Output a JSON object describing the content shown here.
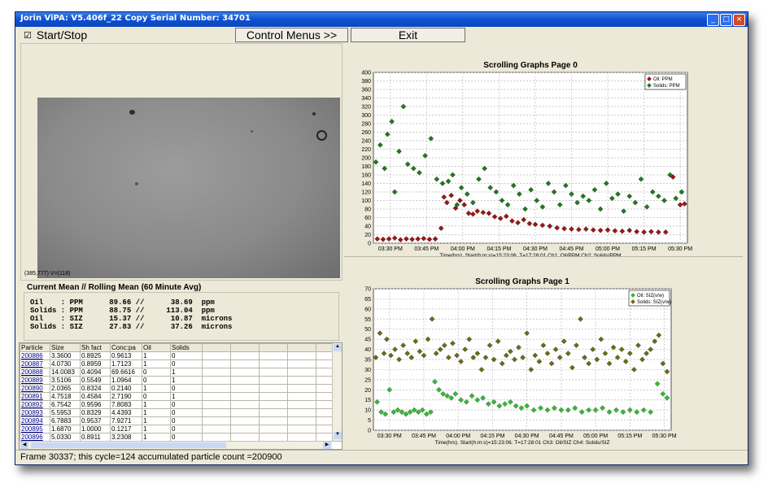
{
  "window": {
    "title": "Jorin ViPA: V5.406f_22 Copy Serial Number: 34701"
  },
  "toolbar": {
    "start_stop_label": "Start/Stop",
    "start_stop_checked": true,
    "control_menus_label": "Control Menus >>",
    "exit_label": "Exit"
  },
  "video": {
    "readout": "(385,777)  V=(118)"
  },
  "stats": {
    "title": "Current Mean // Rolling Mean (60 Minute Avg)",
    "rows": [
      "Oil    : PPM      89.66 //      38.69  ppm",
      "Solids : PPM      88.75 //     113.04  ppm",
      "Oil    : SIZ      15.37 //      10.87  microns",
      "Solids : SIZ      27.83 //      37.26  microns"
    ]
  },
  "table": {
    "headers": [
      "Particle",
      "Size",
      "Sh fact",
      "Conc:pa",
      "Oil",
      "Solids",
      "",
      "",
      "",
      "",
      ""
    ],
    "rows": [
      [
        "200886",
        "3.3600",
        "0.8925",
        "0.9613",
        "1",
        "0"
      ],
      [
        "200887",
        "4.0730",
        "0.8959",
        "1.7123",
        "1",
        "0"
      ],
      [
        "200888",
        "14.0083",
        "0.4094",
        "69.6616",
        "0",
        "1"
      ],
      [
        "200889",
        "3.5106",
        "0.5549",
        "1.0964",
        "0",
        "1"
      ],
      [
        "200890",
        "2.0365",
        "0.8324",
        "0.2140",
        "1",
        "0"
      ],
      [
        "200891",
        "4.7518",
        "0.4584",
        "2.7190",
        "0",
        "1"
      ],
      [
        "200892",
        "6.7542",
        "0.9596",
        "7.8083",
        "1",
        "0"
      ],
      [
        "200893",
        "5.5953",
        "0.8329",
        "4.4393",
        "1",
        "0"
      ],
      [
        "200894",
        "6.7883",
        "0.9537",
        "7.9271",
        "1",
        "0"
      ],
      [
        "200895",
        "1.6870",
        "1.0000",
        "0.1217",
        "1",
        "0"
      ],
      [
        "200896",
        "5.0330",
        "0.8911",
        "3.2308",
        "1",
        "0"
      ]
    ]
  },
  "status": {
    "text": "Frame 30337; this cycle=124 accumulated particle count =200900"
  },
  "chart_data": [
    {
      "type": "scatter",
      "title": "Scrolling Graphs Page 0",
      "xlabel": "Time(hrs). Start(h:m:s)=15:23:06.  T=17:28:01  Ch1: Oil/PPM  Ch2: Solids/PPM",
      "ylabel": "",
      "xlim": [
        15.383,
        17.55
      ],
      "ylim": [
        0,
        400
      ],
      "yticks": [
        0,
        20,
        40,
        60,
        80,
        100,
        120,
        140,
        160,
        180,
        200,
        220,
        240,
        260,
        280,
        300,
        320,
        340,
        360,
        380,
        400
      ],
      "xticks": [
        "03:30 PM",
        "03:45 PM",
        "04:00 PM",
        "04:15 PM",
        "04:30 PM",
        "04:45 PM",
        "05:00 PM",
        "05:15 PM",
        "05:30 PM"
      ],
      "xtick_values": [
        15.5,
        15.75,
        16.0,
        16.25,
        16.5,
        16.75,
        17.0,
        17.25,
        17.5
      ],
      "grid": true,
      "legend": "top-right",
      "series": [
        {
          "name": "Oil: PPM",
          "color": "#9e1414",
          "x": [
            15.41,
            15.45,
            15.49,
            15.53,
            15.57,
            15.61,
            15.65,
            15.69,
            15.73,
            15.77,
            15.81,
            15.85,
            15.87,
            15.89,
            15.92,
            15.95,
            15.98,
            16.01,
            16.04,
            16.07,
            16.1,
            16.14,
            16.18,
            16.22,
            16.26,
            16.3,
            16.34,
            16.38,
            16.42,
            16.46,
            16.5,
            16.55,
            16.6,
            16.65,
            16.7,
            16.75,
            16.8,
            16.85,
            16.9,
            16.95,
            17.0,
            17.05,
            17.1,
            17.15,
            17.2,
            17.25,
            17.3,
            17.35,
            17.4,
            17.45,
            17.5,
            17.53
          ],
          "y": [
            10,
            9,
            10,
            12,
            8,
            10,
            9,
            10,
            11,
            9,
            10,
            35,
            108,
            95,
            112,
            82,
            100,
            90,
            70,
            68,
            75,
            72,
            70,
            62,
            58,
            63,
            52,
            48,
            55,
            46,
            44,
            42,
            40,
            36,
            34,
            33,
            32,
            33,
            31,
            30,
            31,
            29,
            28,
            30,
            27,
            26,
            27,
            26,
            26,
            155,
            90,
            92
          ]
        },
        {
          "name": "Solids: PPM",
          "color": "#1f7a1f",
          "x": [
            15.4,
            15.43,
            15.46,
            15.48,
            15.51,
            15.53,
            15.56,
            15.59,
            15.62,
            15.66,
            15.7,
            15.74,
            15.78,
            15.82,
            15.86,
            15.9,
            15.93,
            15.96,
            15.99,
            16.03,
            16.07,
            16.11,
            16.15,
            16.19,
            16.23,
            16.27,
            16.31,
            16.35,
            16.39,
            16.43,
            16.47,
            16.51,
            16.55,
            16.59,
            16.63,
            16.67,
            16.71,
            16.75,
            16.79,
            16.83,
            16.87,
            16.91,
            16.95,
            16.99,
            17.03,
            17.07,
            17.11,
            17.15,
            17.19,
            17.23,
            17.27,
            17.31,
            17.35,
            17.39,
            17.43,
            17.47,
            17.51
          ],
          "y": [
            190,
            230,
            175,
            255,
            285,
            120,
            215,
            320,
            185,
            175,
            165,
            205,
            245,
            150,
            140,
            145,
            160,
            90,
            130,
            115,
            95,
            150,
            175,
            130,
            120,
            100,
            90,
            135,
            115,
            80,
            125,
            100,
            85,
            140,
            120,
            90,
            135,
            115,
            95,
            110,
            100,
            125,
            80,
            140,
            105,
            115,
            75,
            110,
            95,
            150,
            85,
            120,
            110,
            100,
            160,
            105,
            120
          ]
        }
      ]
    },
    {
      "type": "scatter",
      "title": "Scrolling Graphs Page 1",
      "xlabel": "Time(hrs). Start(h:m:s)=15:23:06.  T=17:28:01  Ch3: Oil/SIZ  Ch4: Solids/SIZ",
      "ylabel": "",
      "xlim": [
        15.383,
        17.55
      ],
      "ylim": [
        0,
        70
      ],
      "yticks": [
        0,
        5,
        10,
        15,
        20,
        25,
        30,
        35,
        40,
        45,
        50,
        55,
        60,
        65,
        70
      ],
      "xticks": [
        "03:30 PM",
        "03:45 PM",
        "04:00 PM",
        "04:15 PM",
        "04:30 PM",
        "04:45 PM",
        "05:00 PM",
        "05:15 PM",
        "05:30 PM"
      ],
      "xtick_values": [
        15.5,
        15.75,
        16.0,
        16.25,
        16.5,
        16.75,
        17.0,
        17.25,
        17.5
      ],
      "grid": true,
      "legend": "top-right",
      "series": [
        {
          "name": "Oil: SIZ(v/w)",
          "color": "#33bb33",
          "x": [
            15.41,
            15.44,
            15.47,
            15.5,
            15.53,
            15.56,
            15.59,
            15.62,
            15.65,
            15.68,
            15.71,
            15.74,
            15.77,
            15.8,
            15.83,
            15.86,
            15.89,
            15.92,
            15.95,
            15.98,
            16.02,
            16.06,
            16.1,
            16.14,
            16.18,
            16.22,
            16.26,
            16.3,
            16.34,
            16.38,
            16.42,
            16.46,
            16.5,
            16.55,
            16.6,
            16.65,
            16.7,
            16.75,
            16.8,
            16.85,
            16.9,
            16.95,
            17.0,
            17.05,
            17.1,
            17.15,
            17.2,
            17.25,
            17.3,
            17.35,
            17.4,
            17.45,
            17.49,
            17.52
          ],
          "y": [
            14,
            9,
            8,
            20,
            9,
            10,
            9,
            8,
            9,
            10,
            9,
            10,
            8,
            9,
            24,
            20,
            18,
            17,
            16,
            18,
            15,
            14,
            17,
            15,
            16,
            13,
            14,
            12,
            13,
            14,
            12,
            11,
            12,
            10,
            11,
            10,
            11,
            10,
            10,
            11,
            9,
            10,
            10,
            11,
            9,
            10,
            9,
            10,
            9,
            10,
            9,
            23,
            18,
            16
          ]
        },
        {
          "name": "Solids: SIZ(v/w)",
          "color": "#6b6b14",
          "x": [
            15.4,
            15.43,
            15.46,
            15.48,
            15.51,
            15.54,
            15.57,
            15.6,
            15.63,
            15.66,
            15.69,
            15.72,
            15.75,
            15.78,
            15.81,
            15.84,
            15.87,
            15.9,
            15.93,
            15.96,
            15.99,
            16.02,
            16.05,
            16.08,
            16.11,
            16.14,
            16.17,
            16.2,
            16.23,
            16.26,
            16.29,
            16.32,
            16.35,
            16.38,
            16.41,
            16.44,
            16.47,
            16.5,
            16.53,
            16.56,
            16.59,
            16.62,
            16.65,
            16.68,
            16.71,
            16.74,
            16.77,
            16.8,
            16.83,
            16.86,
            16.89,
            16.92,
            16.95,
            16.98,
            17.01,
            17.04,
            17.07,
            17.1,
            17.13,
            17.16,
            17.19,
            17.22,
            17.25,
            17.28,
            17.31,
            17.34,
            17.37,
            17.4,
            17.43,
            17.46,
            17.49,
            17.52
          ],
          "y": [
            36,
            48,
            38,
            45,
            37,
            40,
            35,
            42,
            38,
            36,
            44,
            39,
            37,
            45,
            55,
            38,
            40,
            42,
            36,
            43,
            37,
            34,
            40,
            45,
            36,
            38,
            30,
            36,
            42,
            35,
            44,
            33,
            37,
            39,
            35,
            41,
            36,
            48,
            30,
            37,
            34,
            42,
            38,
            33,
            40,
            36,
            44,
            38,
            31,
            42,
            55,
            36,
            33,
            40,
            35,
            45,
            38,
            33,
            41,
            36,
            40,
            34,
            38,
            30,
            42,
            35,
            38,
            40,
            44,
            47,
            33,
            29
          ]
        }
      ]
    }
  ]
}
